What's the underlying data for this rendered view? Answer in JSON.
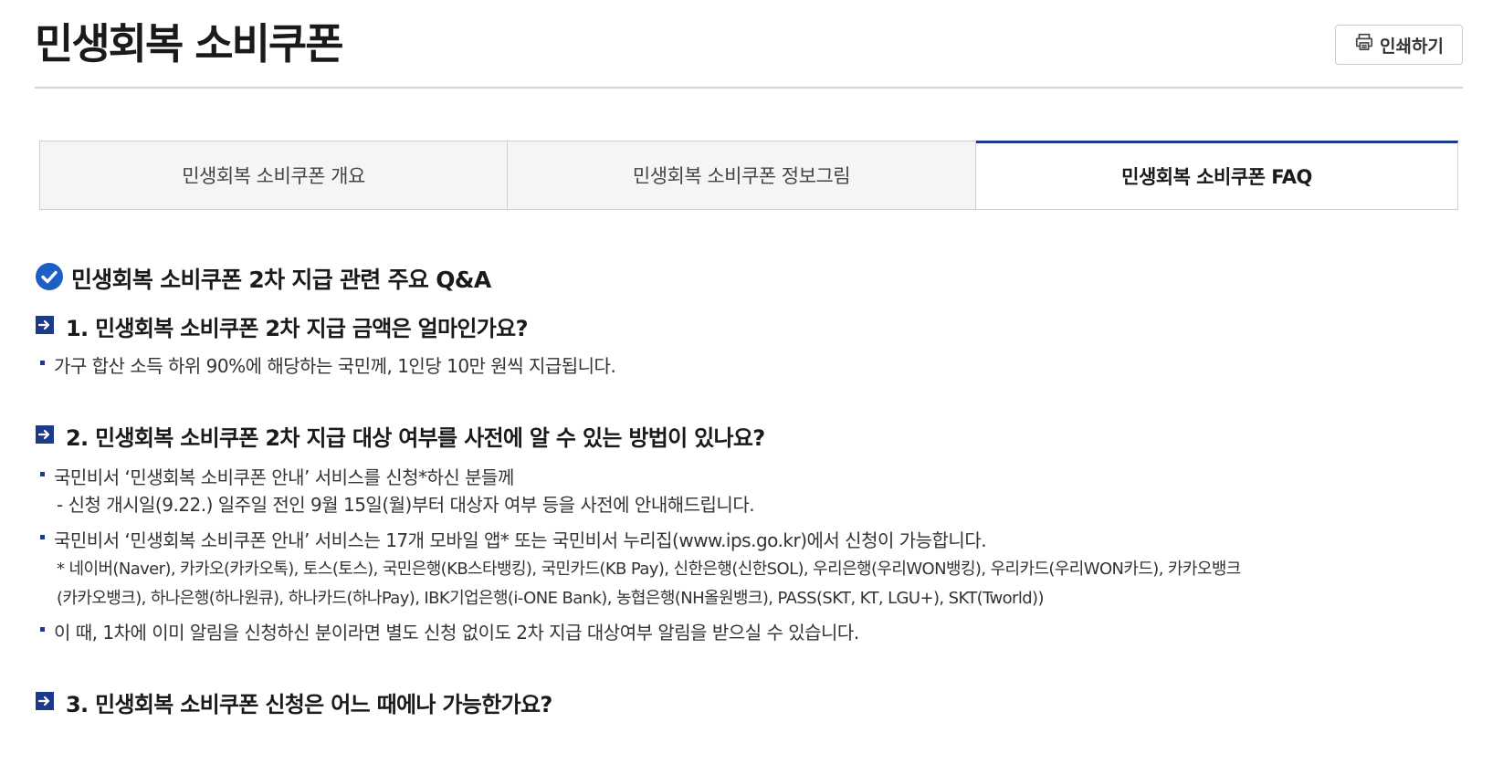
{
  "page": {
    "title": "민생회복 소비쿠폰",
    "print_label": "인쇄하기"
  },
  "tabs": [
    {
      "label": "민생회복 소비쿠폰 개요",
      "active": false
    },
    {
      "label": "민생회복 소비쿠폰 정보그림",
      "active": false
    },
    {
      "label": "민생회복 소비쿠폰 FAQ",
      "active": true
    }
  ],
  "section": {
    "title": "민생회복 소비쿠폰 2차 지급 관련 주요 Q&A"
  },
  "faq": [
    {
      "question": "1. 민생회복 소비쿠폰 2차 지급 금액은 얼마인가요?",
      "a1": "가구 합산 소득 하위 90%에 해당하는 국민께, 1인당 10만 원씩 지급됩니다."
    },
    {
      "question": "2. 민생회복 소비쿠폰 2차 지급 대상 여부를 사전에 알 수 있는 방법이 있나요?",
      "a1": "국민비서 ‘민생회복 소비쿠폰 안내’ 서비스를 신청*하신 분들께",
      "a1_sub": "- 신청 개시일(9.22.) 일주일 전인 9월 15일(월)부터 대상자 여부 등을 사전에 안내해드립니다.",
      "a2": "국민비서 ‘민생회복 소비쿠폰 안내’ 서비스는 17개 모바일 앱* 또는 국민비서 누리집(www.ips.go.kr)에서 신청이 가능합니다.",
      "a2_note1": "* 네이버(Naver), 카카오(카카오톡), 토스(토스), 국민은행(KB스타뱅킹), 국민카드(KB Pay), 신한은행(신한SOL), 우리은행(우리WON뱅킹), 우리카드(우리WON카드), 카카오뱅크",
      "a2_note2": "(카카오뱅크), 하나은행(하나원큐), 하나카드(하나Pay), IBK기업은행(i-ONE Bank), 농협은행(NH올원뱅크), PASS(SKT, KT, LGU+), SKT(Tworld))",
      "a3": "이 때, 1차에 이미 알림을 신청하신 분이라면 별도 신청 없이도 2차 지급 대상여부 알림을 받으실 수 있습니다."
    },
    {
      "question": "3. 민생회복 소비쿠폰 신청은 어느 때에나 가능한가요?"
    }
  ],
  "colors": {
    "accent": "#1b3a8a",
    "check": "#1e5fc6"
  },
  "icons": {
    "print": "printer-icon",
    "section": "check-circle-icon",
    "question": "arrow-right-square-icon"
  }
}
